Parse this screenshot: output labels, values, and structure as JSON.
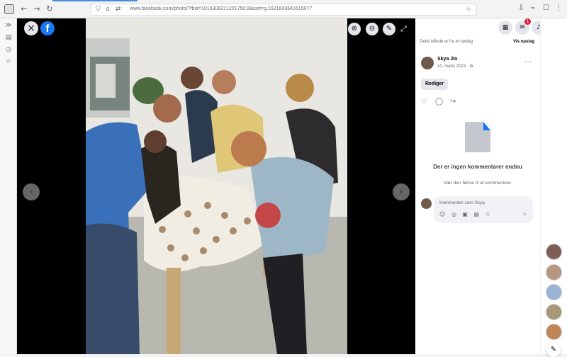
{
  "browser": {
    "url": "www.facebook.com/photo/?fbid=101630822120175018&set=g.1621603641615077",
    "icons": [
      "back-icon",
      "forward-icon",
      "reload-icon",
      "shield-icon",
      "lock-icon",
      "star-icon",
      "download-icon",
      "extensions-icon"
    ]
  },
  "viewer": {
    "close_icon": "×",
    "logo": "f",
    "tool_icons": [
      "zoom-in-icon",
      "zoom-out-icon",
      "tag-icon",
      "fullscreen-icon"
    ],
    "prev_arrow": "‹",
    "next_arrow": "›"
  },
  "panel": {
    "notice_text": "Dette billede er fra et opslag",
    "notice_link": "Vis opslag",
    "author_name": "Skya Jin",
    "post_date": "10. marts 2023 · ⚙",
    "more": "···",
    "edit_label": "Rediger",
    "empty_title": "Der er ingen kommentarer endnu",
    "empty_subtitle": "Vær den første til at kommentere.",
    "comment_placeholder": "Kommenter som Skya",
    "comment_tools": "☺ ◎ ▣ ▤ ☆",
    "send_icon": "➤",
    "notification_count": "1"
  },
  "colors": {
    "facebook_blue": "#1877f2",
    "light_gray": "#e4e6eb",
    "photo_background": "#000000"
  }
}
